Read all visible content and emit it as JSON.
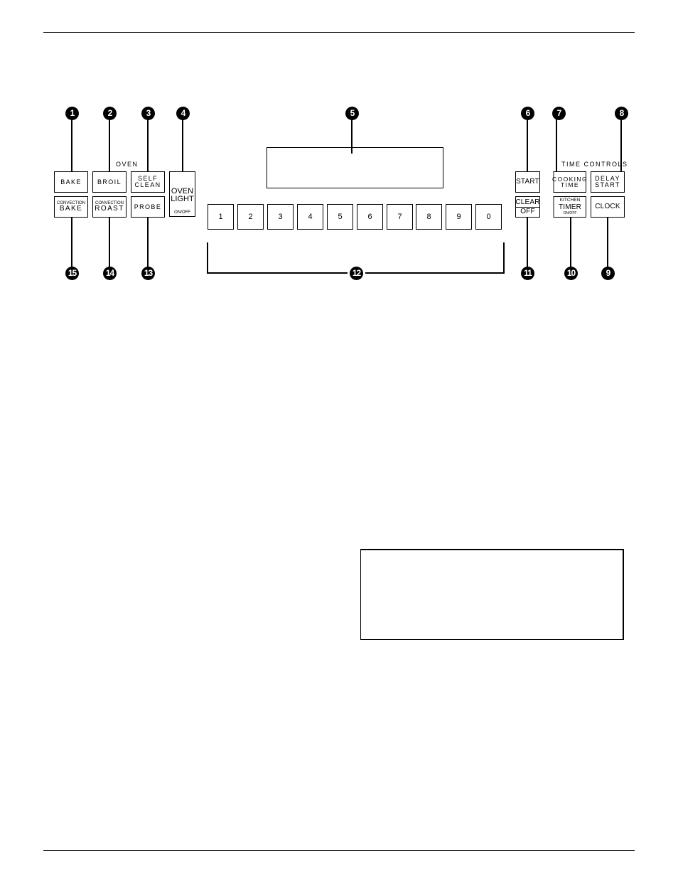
{
  "page": {
    "title": "Oven control panel diagram"
  },
  "oven_group": {
    "title": "OVEN",
    "buttons": [
      {
        "id": 1,
        "lines": [
          "BAKE"
        ]
      },
      {
        "id": 2,
        "lines": [
          "BROIL"
        ]
      },
      {
        "id": 3,
        "lines": [
          "SELF",
          "CLEAN"
        ]
      },
      {
        "id": 4,
        "main": [
          "OVEN",
          "LIGHT"
        ],
        "sub": "ON/OFF"
      },
      {
        "id": 15,
        "top": "CONVECTION",
        "main": "BAKE"
      },
      {
        "id": 14,
        "top": "CONVECTION",
        "main": "ROAST"
      },
      {
        "id": 13,
        "lines": [
          "PROBE"
        ]
      }
    ]
  },
  "display": {
    "callout": "5",
    "value": ""
  },
  "number_pad": {
    "keys": [
      "1",
      "2",
      "3",
      "4",
      "5",
      "6",
      "7",
      "8",
      "9",
      "0"
    ],
    "callout": "12"
  },
  "time_group": {
    "title": "TIME CONTROLS",
    "buttons": [
      {
        "id": 6,
        "lines": [
          "START"
        ]
      },
      {
        "id": 7,
        "lines": [
          "COOKING",
          "TIME"
        ]
      },
      {
        "id": 8,
        "lines": [
          "DELAY",
          "START"
        ]
      },
      {
        "id": 11,
        "top": "CLEAR",
        "main": "OFF"
      },
      {
        "id": 10,
        "top": "KITCHEN",
        "main": "TIMER",
        "sub": "ON/OFF"
      },
      {
        "id": 9,
        "lines": [
          "CLOCK"
        ]
      }
    ]
  },
  "callouts": [
    "1",
    "2",
    "3",
    "4",
    "5",
    "6",
    "7",
    "8",
    "9",
    "10",
    "11",
    "12",
    "13",
    "14",
    "15"
  ],
  "note_box": {
    "text": ""
  }
}
